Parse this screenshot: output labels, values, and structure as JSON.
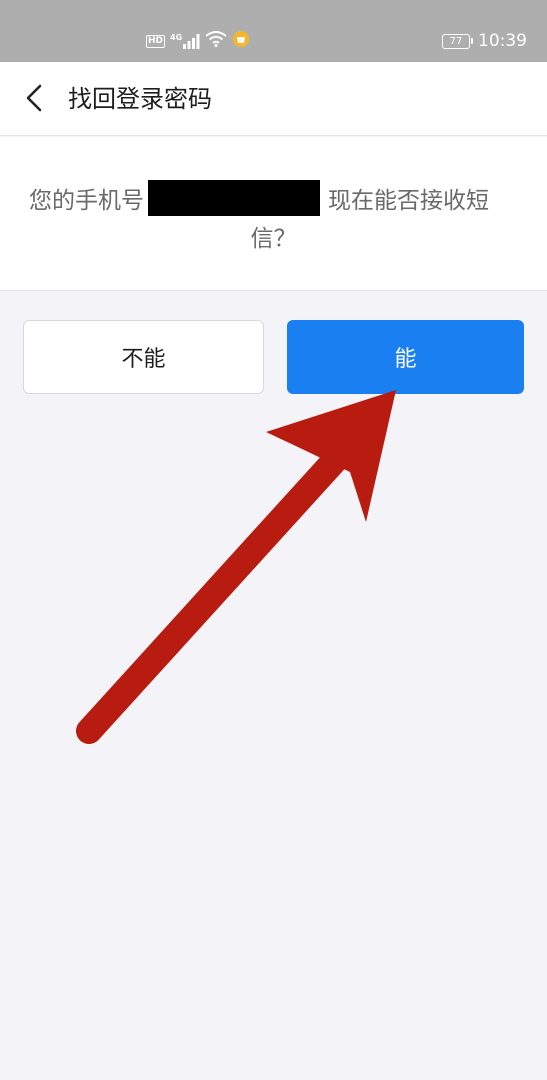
{
  "status_bar": {
    "hd_label": "HD",
    "network_label": "4G",
    "battery_level": "77",
    "time": "10:39"
  },
  "nav": {
    "title": "找回登录密码"
  },
  "message": {
    "prefix": "您的手机号",
    "suffix": "现在能否接收短",
    "line2": "信？"
  },
  "actions": {
    "no_label": "不能",
    "yes_label": "能"
  },
  "colors": {
    "primary": "#1a7ff1",
    "status_bar": "#aeaeae",
    "background": "#f4f3f8",
    "arrow": "#b81c10"
  }
}
